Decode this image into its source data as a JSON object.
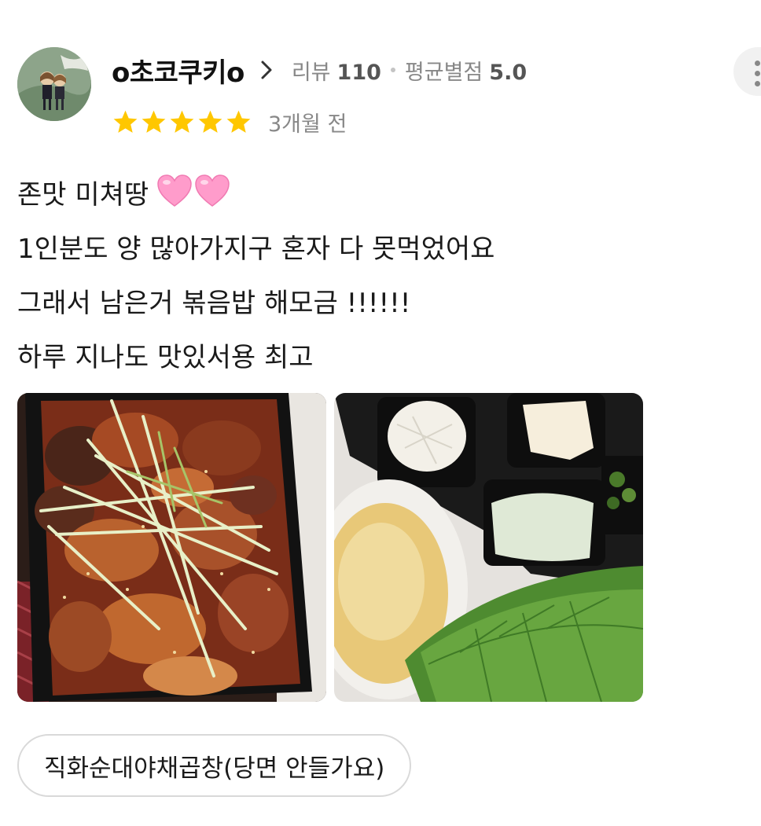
{
  "reviewer": {
    "name": "o초코쿠키o",
    "review_label": "리뷰",
    "review_count": "110",
    "avg_label": "평균별점",
    "avg_rating": "5.0"
  },
  "review": {
    "rating": 5,
    "date": "3개월 전",
    "lines": [
      "존맛 미쳐땅",
      "1인분도 양 많아가지구 혼자 다 못먹었어요",
      "그래서 남은거 볶음밥 해모금 !!!!!!",
      "하루 지나도 맛있서용 최고"
    ],
    "emoji": "pink-hearts-emoji"
  },
  "photos": [
    {
      "subject": "spicy-stir-fried-gopchang-photo"
    },
    {
      "subject": "side-dishes-photo"
    }
  ],
  "menu_tag": "직화순대야채곱창(당면 안들가요)",
  "colors": {
    "star": "#FFC700",
    "muted_text": "#888888",
    "chip_border": "#D9D9D9"
  }
}
